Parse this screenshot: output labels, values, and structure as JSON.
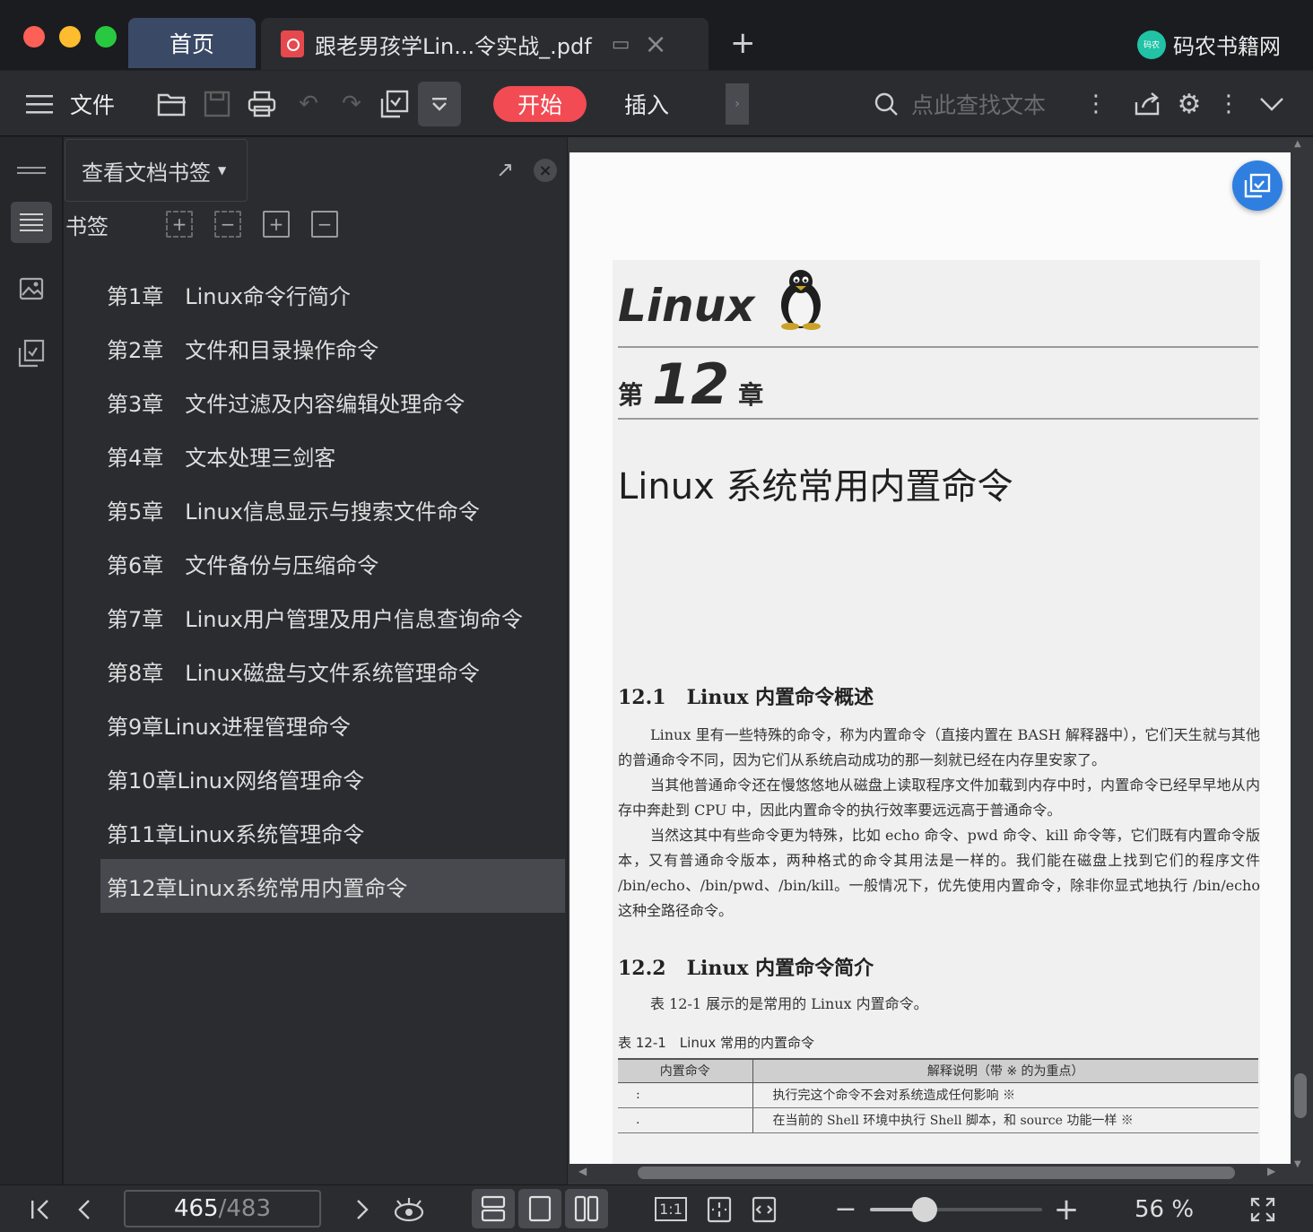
{
  "window": {
    "tabs": [
      {
        "label": "首页"
      },
      {
        "label": "跟老男孩学Lin...令实战_.pdf"
      }
    ],
    "new_tab": "+",
    "brand": {
      "logo_text": "码农",
      "name": "码农书籍网",
      "color": "#21c2a6"
    }
  },
  "toolbar": {
    "file_label": "文件",
    "start_label": "开始",
    "insert_label": "插入",
    "search_placeholder": "点此查找文本",
    "accent": "#f24b53",
    "icons": [
      "menu-icon",
      "open-folder-icon",
      "save-icon",
      "print-icon",
      "undo-icon",
      "redo-icon",
      "convert-icon",
      "more-dropdown-icon",
      "search-icon",
      "more-vertical-icon",
      "share-icon",
      "gear-icon",
      "chevron-down-icon"
    ]
  },
  "bookmark_panel": {
    "dropdown_label": "查看文档书签",
    "section_label": "书签",
    "items": [
      {
        "label": "第1章　Linux命令行简介"
      },
      {
        "label": "第2章　文件和目录操作命令"
      },
      {
        "label": "第3章　文件过滤及内容编辑处理命令"
      },
      {
        "label": "第4章　文本处理三剑客"
      },
      {
        "label": "第5章　Linux信息显示与搜索文件命令"
      },
      {
        "label": "第6章　文件备份与压缩命令"
      },
      {
        "label": "第7章　Linux用户管理及用户信息查询命令"
      },
      {
        "label": "第8章　Linux磁盘与文件系统管理命令"
      },
      {
        "label": "第9章Linux进程管理命令"
      },
      {
        "label": "第10章Linux网络管理命令"
      },
      {
        "label": "第11章Linux系统管理命令"
      },
      {
        "label": "第12章Linux系统常用内置命令"
      }
    ],
    "selected_index": 11
  },
  "document": {
    "chapter_brand": "Linux",
    "chapter_prefix": "第",
    "chapter_number": "12",
    "chapter_suffix": "章",
    "chapter_title": "Linux 系统常用内置命令",
    "sections": [
      {
        "number": "12.1",
        "title": "Linux 内置命令概述",
        "paragraphs": [
          "Linux 里有一些特殊的命令，称为内置命令（直接内置在 BASH 解释器中），它们天生就与其他的普通命令不同，因为它们从系统启动成功的那一刻就已经在内存里安家了。",
          "当其他普通命令还在慢悠悠地从磁盘上读取程序文件加载到内存中时，内置命令已经早早地从内存中奔赴到 CPU 中，因此内置命令的执行效率要远远高于普通命令。",
          "当然这其中有些命令更为特殊，比如 echo 命令、pwd 命令、kill 命令等，它们既有内置命令版本，又有普通命令版本，两种格式的命令其用法是一样的。我们能在磁盘上找到它们的程序文件 /bin/echo、/bin/pwd、/bin/kill。一般情况下，优先使用内置命令，除非你显式地执行 /bin/echo 这种全路径命令。"
        ]
      },
      {
        "number": "12.2",
        "title": "Linux 内置命令简介",
        "paragraphs": [
          "表 12-1 展示的是常用的 Linux 内置命令。"
        ]
      }
    ],
    "table": {
      "caption": "表 12-1　Linux 常用的内置命令",
      "headers": [
        "内置命令",
        "解释说明（带 ※ 的为重点）"
      ],
      "rows": [
        [
          ":",
          "执行完这个命令不会对系统造成任何影响 ※"
        ],
        [
          ".",
          "在当前的 Shell 环境中执行 Shell 脚本，和 source 功能一样 ※"
        ]
      ]
    }
  },
  "statusbar": {
    "current_page": "465",
    "separator": "/",
    "total_pages": "483",
    "zoom": "56 %",
    "zoom_fraction": 0.32,
    "actual_size_label": "1:1"
  }
}
